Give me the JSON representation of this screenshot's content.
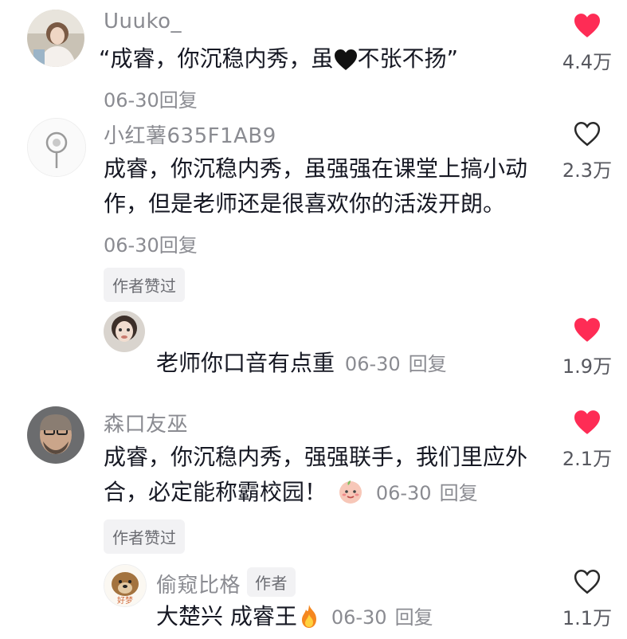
{
  "comments": [
    {
      "username": "Uuuko_",
      "text_prefix": "“成睿，你沉稳内秀，虽",
      "text_suffix": "不张不扬”",
      "date": "06-30",
      "reply_label": "回复",
      "likes": "4.4万",
      "liked": true
    },
    {
      "username": "小红薯635F1AB9",
      "text_line1": "成睿，你沉稳内秀，虽强强在课堂上搞小动",
      "text_line2": "作，但是老师还是很喜欢你的活泼开朗。",
      "date": "06-30",
      "reply_label": "回复",
      "badge": "作者赞过",
      "likes": "2.3万",
      "liked": false
    },
    {
      "text": "老师你口音有点重",
      "date": "06-30",
      "reply_label": "回复",
      "likes": "1.9万",
      "liked": true
    },
    {
      "username": "森口友巫",
      "text_line1": "成睿，你沉稳内秀，强强联手，我们里应外",
      "text_line2": "合，必定能称霸校园！",
      "date": "06-30",
      "reply_label": "回复",
      "badge": "作者赞过",
      "likes": "2.1万",
      "liked": true
    },
    {
      "username": "偷窥比格",
      "author_tag": "作者",
      "text": "大楚兴 成睿王",
      "avatar_text": "好梦",
      "date": "06-30",
      "reply_label": "回复",
      "likes": "1.1万",
      "liked": false
    }
  ],
  "colors": {
    "liked_heart": "#fe2c55",
    "secondary_text": "#8a8b91"
  }
}
